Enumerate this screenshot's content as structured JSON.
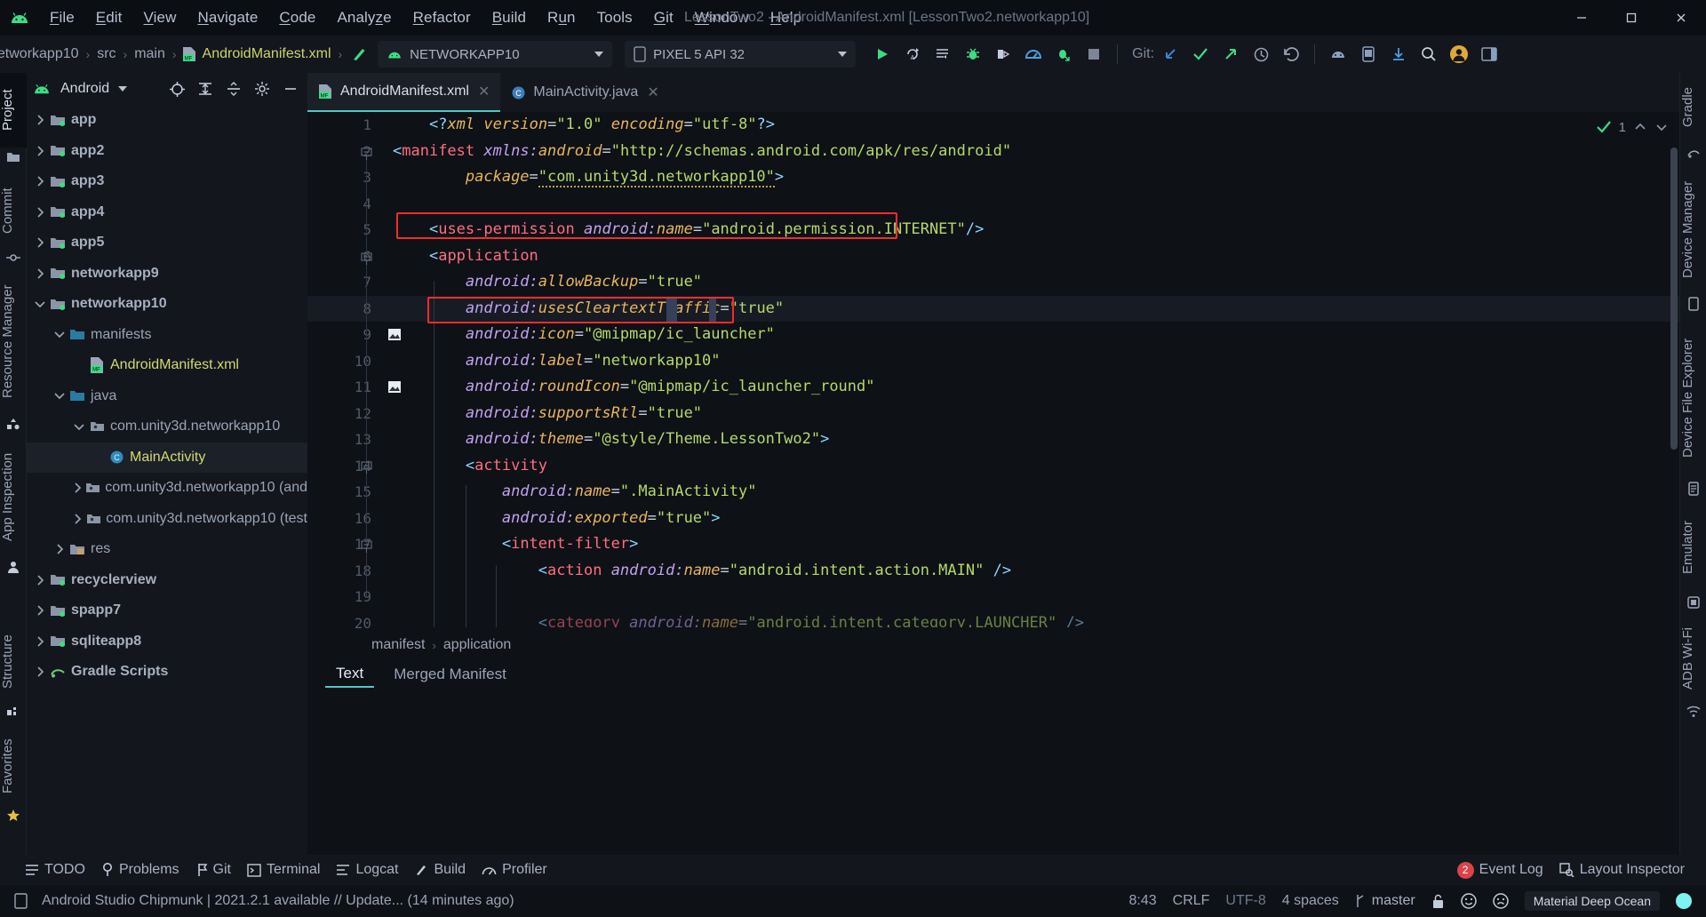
{
  "window": {
    "title": "LessonTwo2 - AndroidManifest.xml [LessonTwo2.networkapp10]",
    "minimize": "−",
    "maximize": "☐",
    "close": "✕"
  },
  "menubar": {
    "items": [
      {
        "label": "File",
        "mnemonic": "F"
      },
      {
        "label": "Edit",
        "mnemonic": "E"
      },
      {
        "label": "View",
        "mnemonic": "V"
      },
      {
        "label": "Navigate",
        "mnemonic": "N"
      },
      {
        "label": "Code",
        "mnemonic": "C"
      },
      {
        "label": "Analyze",
        "mnemonic": ""
      },
      {
        "label": "Refactor",
        "mnemonic": "R"
      },
      {
        "label": "Build",
        "mnemonic": "B"
      },
      {
        "label": "Run",
        "mnemonic": "u"
      },
      {
        "label": "Tools",
        "mnemonic": ""
      },
      {
        "label": "Git",
        "mnemonic": "G"
      },
      {
        "label": "Window",
        "mnemonic": "W"
      },
      {
        "label": "Help",
        "mnemonic": "H"
      }
    ]
  },
  "navbar": {
    "breadcrumbs": [
      "networkapp10",
      "src",
      "main",
      "AndroidManifest.xml"
    ],
    "separator": "›",
    "run_config": "NETWORKAPP10",
    "device": "PIXEL 5 API 32",
    "git_label": "Git:"
  },
  "left_strip": {
    "top_tabs": [
      "Project",
      "Commit",
      "Resource Manager",
      "App Inspection"
    ],
    "bottom_tabs": [
      "Structure",
      "Favorites"
    ]
  },
  "right_strip": {
    "tabs": [
      "Gradle",
      "Device Manager",
      "Device File Explorer",
      "Emulator",
      "ADB Wi-Fi"
    ]
  },
  "project_panel": {
    "title": "Android",
    "tree": [
      {
        "label": "app",
        "indent": 0,
        "arrow": "right",
        "icon": "module-folder",
        "bold": true,
        "yellow": false,
        "selected": false
      },
      {
        "label": "app2",
        "indent": 0,
        "arrow": "right",
        "icon": "module-folder",
        "bold": true,
        "yellow": false,
        "selected": false
      },
      {
        "label": "app3",
        "indent": 0,
        "arrow": "right",
        "icon": "module-folder",
        "bold": true,
        "yellow": false,
        "selected": false
      },
      {
        "label": "app4",
        "indent": 0,
        "arrow": "right",
        "icon": "module-folder",
        "bold": true,
        "yellow": false,
        "selected": false
      },
      {
        "label": "app5",
        "indent": 0,
        "arrow": "right",
        "icon": "module-folder",
        "bold": true,
        "yellow": false,
        "selected": false
      },
      {
        "label": "networkapp9",
        "indent": 0,
        "arrow": "right",
        "icon": "module-folder",
        "bold": true,
        "yellow": false,
        "selected": false
      },
      {
        "label": "networkapp10",
        "indent": 0,
        "arrow": "down",
        "icon": "module-folder",
        "bold": true,
        "yellow": false,
        "selected": false
      },
      {
        "label": "manifests",
        "indent": 1,
        "arrow": "down",
        "icon": "blue-folder",
        "bold": false,
        "yellow": false,
        "selected": false
      },
      {
        "label": "AndroidManifest.xml",
        "indent": 2,
        "arrow": "none",
        "icon": "manifest-file",
        "bold": false,
        "yellow": true,
        "selected": false
      },
      {
        "label": "java",
        "indent": 1,
        "arrow": "down",
        "icon": "blue-folder",
        "bold": false,
        "yellow": false,
        "selected": false
      },
      {
        "label": "com.unity3d.networkapp10",
        "indent": 2,
        "arrow": "down",
        "icon": "package",
        "bold": false,
        "yellow": false,
        "selected": false
      },
      {
        "label": "MainActivity",
        "indent": 3,
        "arrow": "none",
        "icon": "java-class",
        "bold": false,
        "yellow": true,
        "selected": true
      },
      {
        "label": "com.unity3d.networkapp10 (and",
        "indent": 2,
        "arrow": "right",
        "icon": "package",
        "bold": false,
        "yellow": false,
        "selected": false
      },
      {
        "label": "com.unity3d.networkapp10 (test",
        "indent": 2,
        "arrow": "right",
        "icon": "package",
        "bold": false,
        "yellow": false,
        "selected": false
      },
      {
        "label": "res",
        "indent": 1,
        "arrow": "right",
        "icon": "res-folder",
        "bold": false,
        "yellow": false,
        "selected": false
      },
      {
        "label": "recyclerview",
        "indent": 0,
        "arrow": "right",
        "icon": "module-folder",
        "bold": true,
        "yellow": false,
        "selected": false
      },
      {
        "label": "spapp7",
        "indent": 0,
        "arrow": "right",
        "icon": "module-folder",
        "bold": true,
        "yellow": false,
        "selected": false
      },
      {
        "label": "sqliteapp8",
        "indent": 0,
        "arrow": "right",
        "icon": "module-folder",
        "bold": true,
        "yellow": false,
        "selected": false
      },
      {
        "label": "Gradle Scripts",
        "indent": 0,
        "arrow": "right",
        "icon": "gradle",
        "bold": true,
        "yellow": false,
        "selected": false
      }
    ]
  },
  "editor_tabs": [
    {
      "label": "AndroidManifest.xml",
      "icon": "manifest-file",
      "active": true,
      "close": "✕"
    },
    {
      "label": "MainActivity.java",
      "icon": "java-class",
      "active": false,
      "close": "✕"
    }
  ],
  "editor": {
    "inspection_count": "1",
    "lines": [
      {
        "n": "1",
        "text": "    <?xml version=\"1.0\" encoding=\"utf-8\"?>"
      },
      {
        "n": "2",
        "text": "<manifest xmlns:android=\"http://schemas.android.com/apk/res/android\""
      },
      {
        "n": "3",
        "text": "        package=\"com.unity3d.networkapp10\">"
      },
      {
        "n": "4",
        "text": ""
      },
      {
        "n": "5",
        "text": "    <uses-permission android:name=\"android.permission.INTERNET\"/>"
      },
      {
        "n": "6",
        "text": "    <application"
      },
      {
        "n": "7",
        "text": "        android:allowBackup=\"true\""
      },
      {
        "n": "8",
        "text": "        android:usesCleartextTraffic=\"true\""
      },
      {
        "n": "9",
        "text": "        android:icon=\"@mipmap/ic_launcher\""
      },
      {
        "n": "10",
        "text": "        android:label=\"networkapp10\""
      },
      {
        "n": "11",
        "text": "        android:roundIcon=\"@mipmap/ic_launcher_round\""
      },
      {
        "n": "12",
        "text": "        android:supportsRtl=\"true\""
      },
      {
        "n": "13",
        "text": "        android:theme=\"@style/Theme.LessonTwo2\">"
      },
      {
        "n": "14",
        "text": "        <activity"
      },
      {
        "n": "15",
        "text": "            android:name=\".MainActivity\""
      },
      {
        "n": "16",
        "text": "            android:exported=\"true\">"
      },
      {
        "n": "17",
        "text": "            <intent-filter>"
      },
      {
        "n": "18",
        "text": "                <action android:name=\"android.intent.action.MAIN\" />"
      },
      {
        "n": "19",
        "text": ""
      },
      {
        "n": "20",
        "text": "                <category android:name=\"android.intent.category.LAUNCHER\" />"
      }
    ],
    "breadcrumb": [
      "manifest",
      "application"
    ],
    "breadcrumb_sep": "›",
    "bottom_tabs": [
      {
        "label": "Text",
        "active": true
      },
      {
        "label": "Merged Manifest",
        "active": false
      }
    ]
  },
  "bottom_toolwindows": {
    "left": [
      {
        "label": "TODO",
        "icon": "todo-icon"
      },
      {
        "label": "Problems",
        "icon": "problems-icon"
      },
      {
        "label": "Git",
        "icon": "git-icon"
      },
      {
        "label": "Terminal",
        "icon": "terminal-icon"
      },
      {
        "label": "Logcat",
        "icon": "logcat-icon"
      },
      {
        "label": "Build",
        "icon": "build-icon"
      },
      {
        "label": "Profiler",
        "icon": "profiler-icon"
      }
    ],
    "right": [
      {
        "label": "Event Log",
        "icon": "event-log-icon",
        "badge": "2"
      },
      {
        "label": "Layout Inspector",
        "icon": "layout-inspector-icon",
        "badge": ""
      }
    ]
  },
  "statusbar": {
    "message": "Android Studio Chipmunk | 2021.2.1 available // Update... (14 minutes ago)",
    "caret": "8:43",
    "line_sep": "CRLF",
    "encoding": "UTF-8",
    "indent": "4 spaces",
    "branch": "master",
    "theme": "Material Deep Ocean"
  },
  "colors": {
    "accent": "#52c7c0",
    "highlight_box": "#f42c2c",
    "green": "#3ddc84",
    "badge_red": "#d9434a",
    "tag": "#ff6e7f",
    "attr": "#c3a1f0",
    "string": "#b5d96a"
  }
}
